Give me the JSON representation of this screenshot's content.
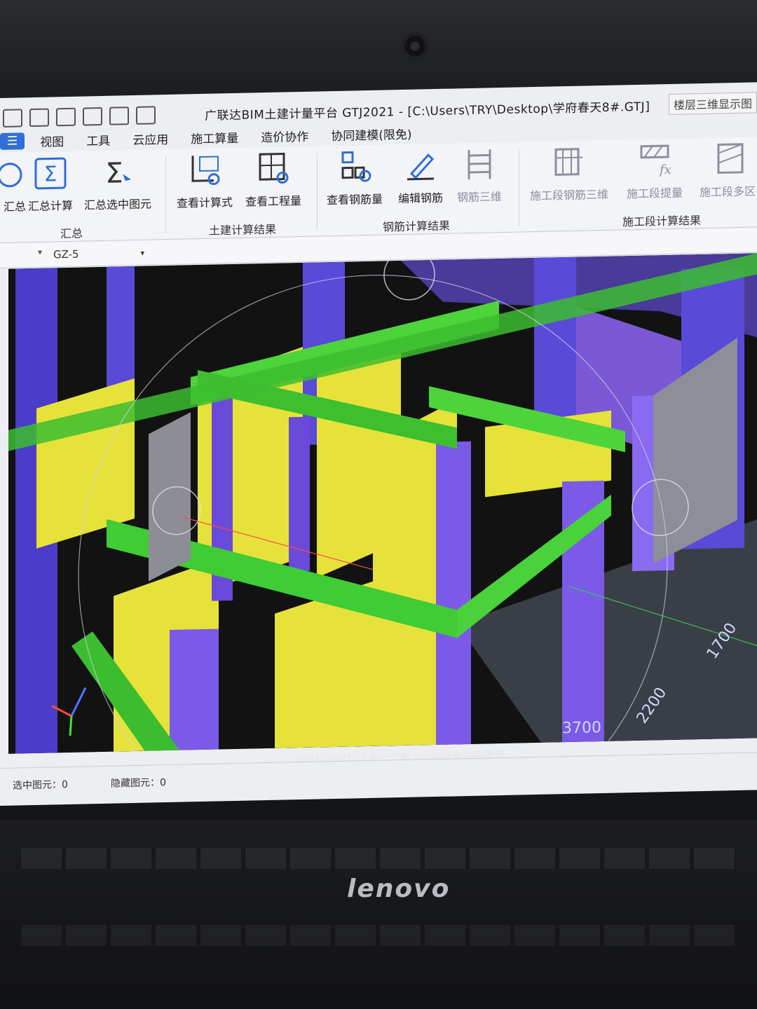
{
  "window": {
    "title": "广联达BIM土建计量平台 GTJ2021 - [C:\\Users\\TRY\\Desktop\\学府春天8#.GTJ]",
    "right_panel_label": "楼层三维显示图"
  },
  "menu": {
    "tabs": [
      {
        "label": "视图"
      },
      {
        "label": "工具"
      },
      {
        "label": "云应用"
      },
      {
        "label": "施工算量"
      },
      {
        "label": "造价协作"
      },
      {
        "label": "协同建模(限免)"
      }
    ]
  },
  "ribbon": {
    "buttons": [
      {
        "label": "汇总",
        "icon": "refresh-icon"
      },
      {
        "label": "汇总计算",
        "icon": "sigma-icon"
      },
      {
        "label": "汇总选中图元",
        "icon": "sigma-select-icon"
      },
      {
        "label": "查看计算式",
        "icon": "calc-view-icon"
      },
      {
        "label": "查看工程量",
        "icon": "quantity-view-icon"
      },
      {
        "label": "查看钢筋量",
        "icon": "rebar-quantity-icon"
      },
      {
        "label": "编辑钢筋",
        "icon": "pencil-icon"
      },
      {
        "label": "钢筋三维",
        "icon": "rebar-3d-icon"
      },
      {
        "label": "施工段钢筋三维",
        "icon": "segment-rebar-3d-icon"
      },
      {
        "label": "施工段提量",
        "icon": "formula-icon"
      },
      {
        "label": "施工段多区",
        "icon": "multi-zone-icon"
      }
    ],
    "groups": [
      {
        "label": "汇总"
      },
      {
        "label": "土建计算结果"
      },
      {
        "label": "钢筋计算结果"
      },
      {
        "label": "施工段计算结果"
      }
    ]
  },
  "selector": {
    "current": "GZ-5"
  },
  "viewport": {
    "hint": "按鼠标左键指定第一个角点，或拾取构件图元",
    "dimensions": [
      "1700",
      "2200",
      "3700"
    ]
  },
  "statusbar": {
    "selected": "选中图元：0",
    "hidden": "隐藏图元：0"
  },
  "hardware": {
    "brand": "lenovo"
  }
}
